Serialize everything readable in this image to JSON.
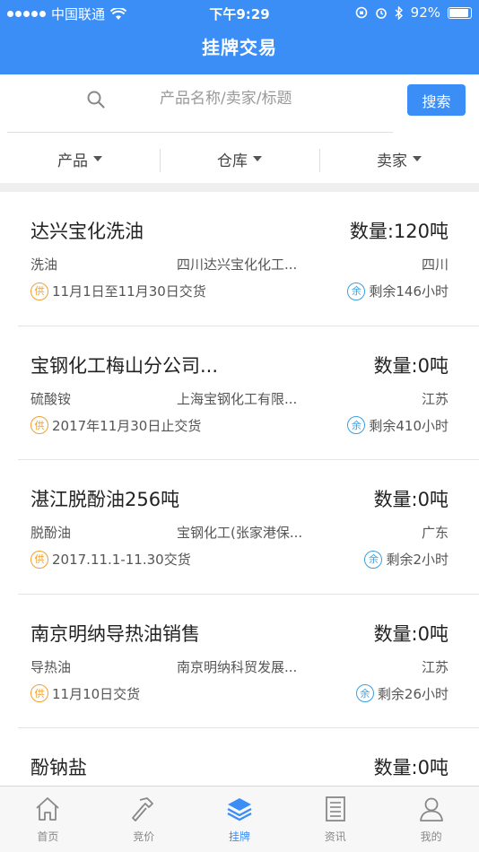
{
  "status_bar": {
    "carrier": "中国联通",
    "time": "下午9:29",
    "battery": "92%",
    "battery_level": 0.92
  },
  "header": {
    "title": "挂牌交易"
  },
  "search": {
    "placeholder": "产品名称/卖家/标题",
    "button_label": "搜索"
  },
  "filters": [
    {
      "label": "产品"
    },
    {
      "label": "仓库"
    },
    {
      "label": "卖家"
    }
  ],
  "badges": {
    "supply": "供",
    "remain": "余"
  },
  "listings": [
    {
      "title": "达兴宝化洗油",
      "quantity": "数量:120吨",
      "product": "洗油",
      "seller": "四川达兴宝化化工...",
      "region": "四川",
      "delivery": "11月1日至11月30日交货",
      "remaining": "剩余146小时"
    },
    {
      "title": "宝钢化工梅山分公司...",
      "quantity": "数量:0吨",
      "product": "硫酸铵",
      "seller": "上海宝钢化工有限...",
      "region": "江苏",
      "delivery": "2017年11月30日止交货",
      "remaining": "剩余410小时"
    },
    {
      "title": "湛江脱酚油256吨",
      "quantity": "数量:0吨",
      "product": "脱酚油",
      "seller": "宝钢化工(张家港保...",
      "region": "广东",
      "delivery": "2017.11.1-11.30交货",
      "remaining": "剩余2小时"
    },
    {
      "title": "南京明纳导热油销售",
      "quantity": "数量:0吨",
      "product": "导热油",
      "seller": "南京明纳科贸发展...",
      "region": "江苏",
      "delivery": "11月10日交货",
      "remaining": "剩余26小时"
    },
    {
      "title": "酚钠盐",
      "quantity": "数量:0吨",
      "product": "",
      "seller": "",
      "region": "",
      "delivery": "",
      "remaining": ""
    }
  ],
  "tabbar": [
    {
      "label": "首页",
      "icon": "home-icon"
    },
    {
      "label": "竞价",
      "icon": "hammer-icon"
    },
    {
      "label": "挂牌",
      "icon": "layers-icon",
      "active": true
    },
    {
      "label": "资讯",
      "icon": "news-icon"
    },
    {
      "label": "我的",
      "icon": "user-icon"
    }
  ],
  "colors": {
    "primary": "#3a8ef6",
    "supply_badge": "#f0a030",
    "remain_badge": "#3aa0e0"
  }
}
